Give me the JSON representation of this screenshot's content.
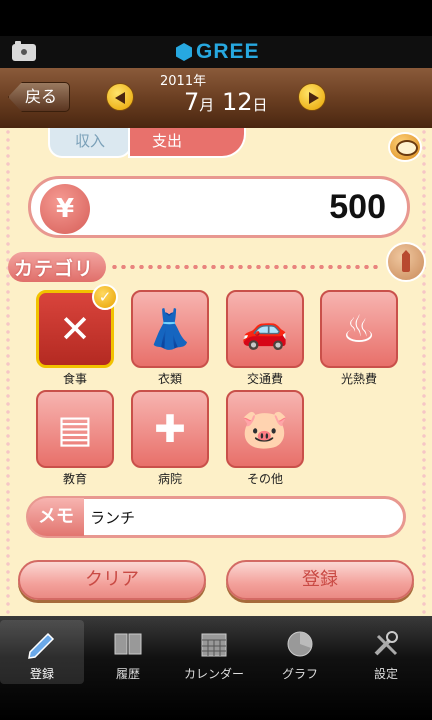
{
  "header": {
    "service_name": "GREE",
    "back_label": "戻る",
    "year": "2011年",
    "month": "7",
    "month_unit": "月",
    "day": "12",
    "day_unit": "日"
  },
  "entry_type_tabs": {
    "income_label": "収入",
    "expense_label": "支出",
    "selected": "expense"
  },
  "amount": {
    "currency_symbol": "¥",
    "value": "500"
  },
  "category_section": {
    "title": "カテゴリ",
    "selected": "食事",
    "items": [
      {
        "label": "食事",
        "icon": "fork-knife-icon"
      },
      {
        "label": "衣類",
        "icon": "dress-icon"
      },
      {
        "label": "交通費",
        "icon": "car-icon"
      },
      {
        "label": "光熱費",
        "icon": "kettle-icon"
      },
      {
        "label": "教育",
        "icon": "book-icon"
      },
      {
        "label": "病院",
        "icon": "first-aid-kit-icon"
      },
      {
        "label": "その他",
        "icon": "piggy-bank-icon"
      }
    ]
  },
  "memo": {
    "label": "メモ",
    "value": "ランチ"
  },
  "actions": {
    "clear_label": "クリア",
    "register_label": "登録"
  },
  "tabbar": {
    "items": [
      {
        "label": "登録",
        "icon": "pencil-icon",
        "active": true
      },
      {
        "label": "履歴",
        "icon": "book-icon"
      },
      {
        "label": "カレンダー",
        "icon": "calendar-icon"
      },
      {
        "label": "グラフ",
        "icon": "pie-chart-icon"
      },
      {
        "label": "設定",
        "icon": "tools-icon"
      }
    ]
  },
  "colors": {
    "accent": "#e8716c",
    "selected_border": "#f2c200",
    "gree_blue": "#27a8e0",
    "header_brown": "#6b3f22"
  }
}
